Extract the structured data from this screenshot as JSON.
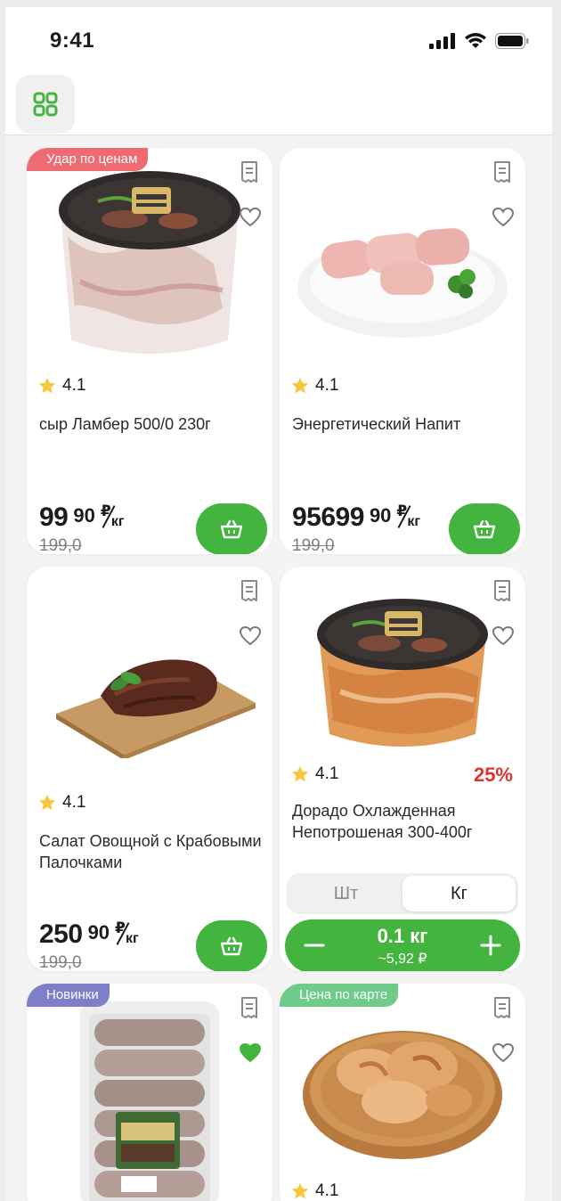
{
  "status_bar": {
    "time": "9:41"
  },
  "colors": {
    "accent": "#43b53f",
    "discount": "#d9352b",
    "badge_sale": "#ee6b72",
    "badge_new": "#7f7fc9",
    "badge_card": "#6fcb8a"
  },
  "products": [
    {
      "badge": "Удар по ценам",
      "rating": "4.1",
      "title": "сыр Ламбер 500/0 230г",
      "price_int": "99",
      "price_frac": "90",
      "currency": "₽",
      "unit": "кг",
      "old_price": "199,0",
      "favorite": false,
      "image": "marinated-meat-bucket"
    },
    {
      "badge": "",
      "rating": "4.1",
      "title": "Энергетический Напит",
      "price_int": "95699",
      "price_frac": "90",
      "currency": "₽",
      "unit": "кг",
      "old_price": "199,0",
      "favorite": false,
      "image": "raw-meat-rolls-plate"
    },
    {
      "badge": "",
      "rating": "4.1",
      "title": "Салат Овощной с Крабовыми Палочками",
      "price_int": "250",
      "price_frac": "90",
      "currency": "₽",
      "unit": "кг",
      "old_price": "199,0",
      "favorite": false,
      "image": "grilled-steak-board"
    },
    {
      "badge": "",
      "rating": "4.1",
      "discount": "25%",
      "title": "Дорадо Охлажденная Непотрошеная 300-400г",
      "unit_toggle": {
        "options": [
          "Шт",
          "Кг"
        ],
        "selected": "Кг"
      },
      "quantity": "0.1 кг",
      "quantity_price": "~5,92 ₽",
      "favorite": false,
      "image": "marinated-chicken-bucket"
    },
    {
      "badge": "Новинки",
      "favorite": true,
      "image": "sausages-pack"
    },
    {
      "badge": "Цена по карте",
      "rating": "4.1",
      "favorite": false,
      "image": "roasted-chicken-board"
    }
  ]
}
